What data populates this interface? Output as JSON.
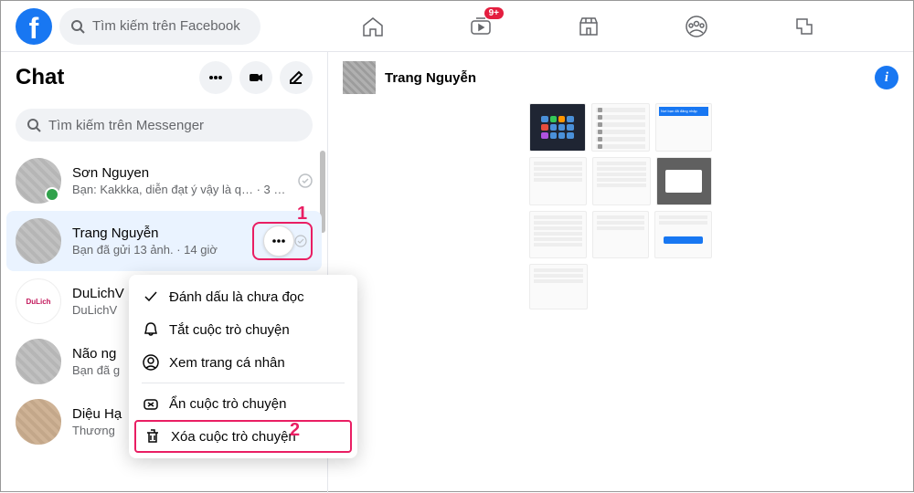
{
  "top_search_placeholder": "Tìm kiếm trên Facebook",
  "watch_badge": "9+",
  "sidebar": {
    "title": "Chat",
    "search_placeholder": "Tìm kiếm trên Messenger",
    "items": [
      {
        "name": "Sơn Nguyen",
        "preview": "Bạn: Kakkka, diễn đạt ý vậy là q… · 3 giờ"
      },
      {
        "name": "Trang Nguyễn",
        "preview": "Bạn đã gửi 13 ảnh. · 14 giờ"
      },
      {
        "name": "DuLichV",
        "preview": "DuLichV"
      },
      {
        "name": "Não ng",
        "preview": "Bạn đã g"
      },
      {
        "name": "Diệu Hạ",
        "preview": "Thương"
      }
    ]
  },
  "callouts": {
    "one": "1",
    "two": "2"
  },
  "context_menu": {
    "mark_unread": "Đánh dấu là chưa đọc",
    "mute": "Tắt cuộc trò chuyện",
    "view_profile": "Xem trang cá nhân",
    "hide": "Ẩn cuộc trò chuyện",
    "delete": "Xóa cuộc trò chuyện"
  },
  "conversation": {
    "name": "Trang Nguyễn"
  }
}
